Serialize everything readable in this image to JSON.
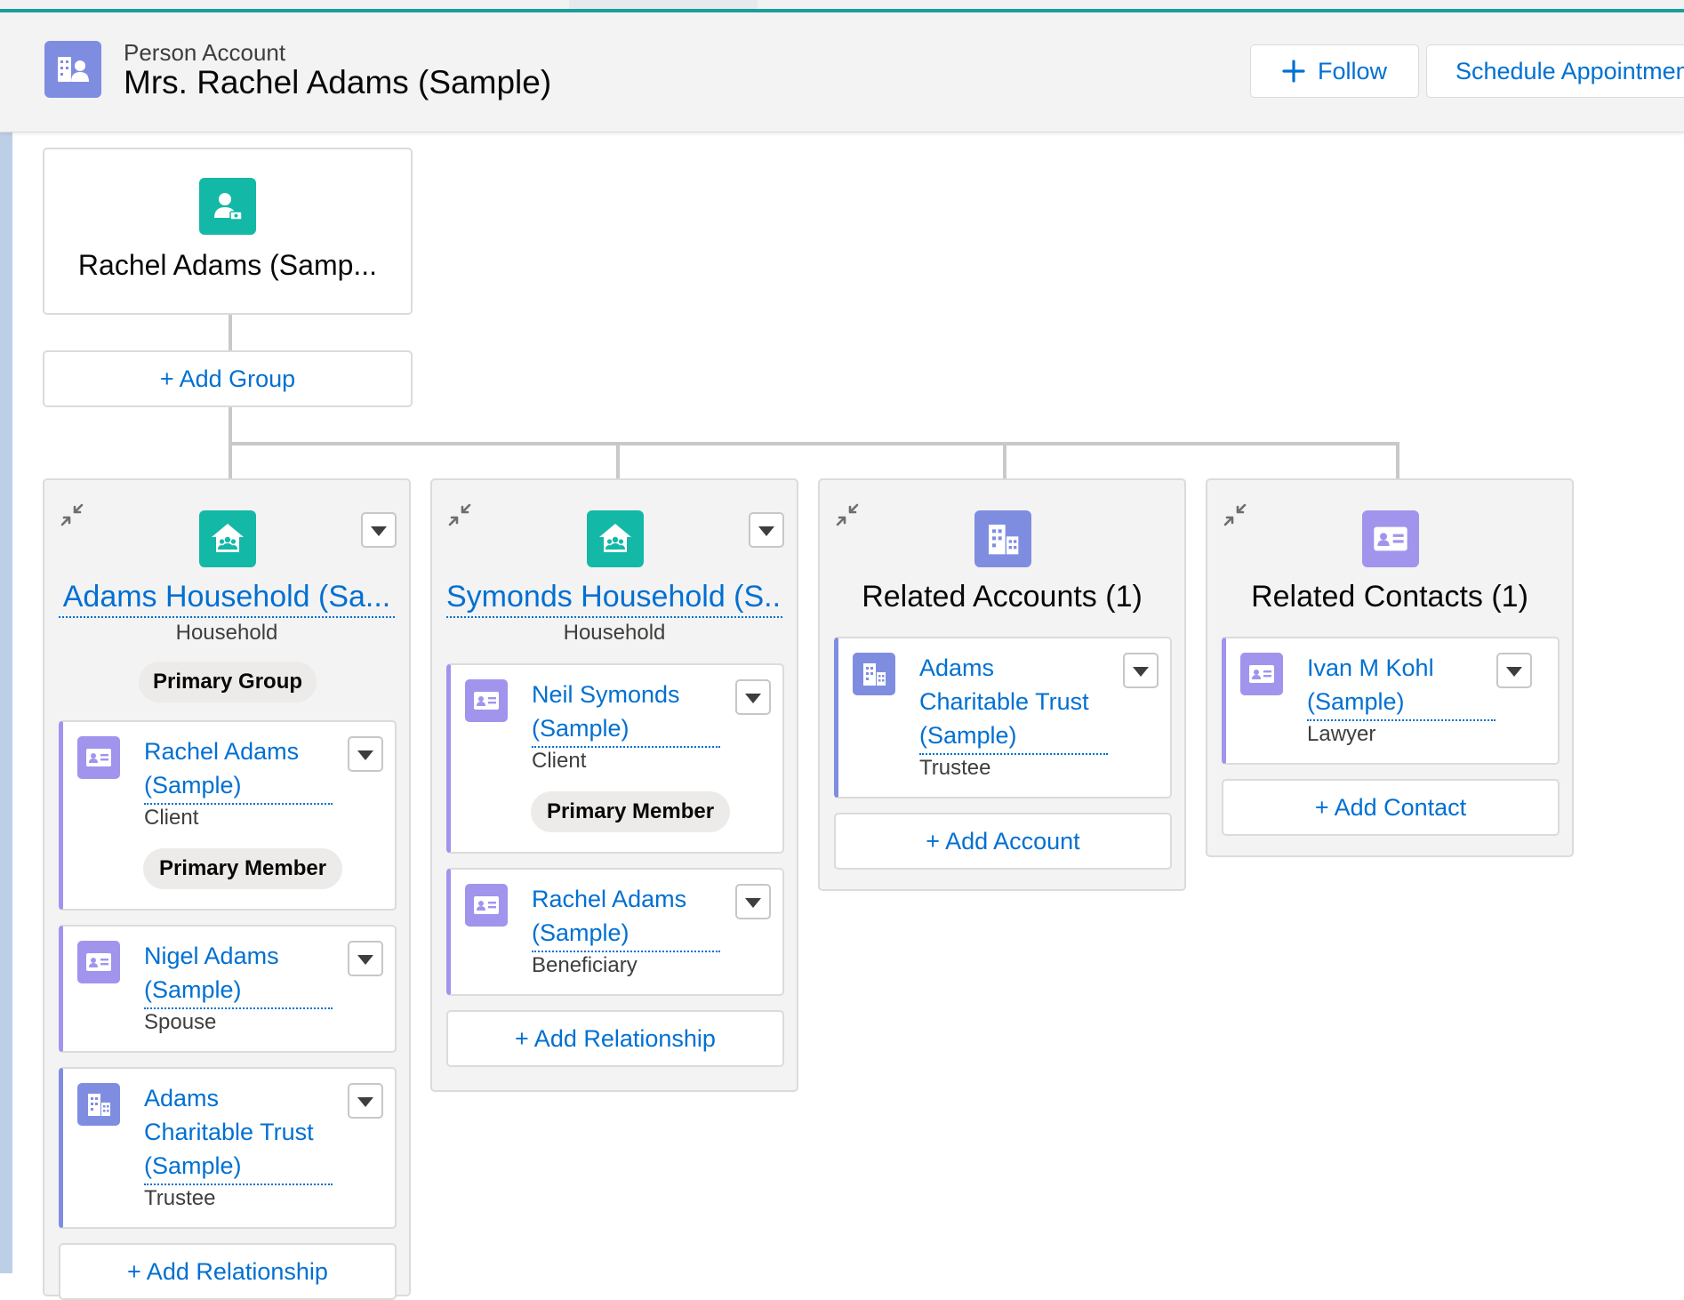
{
  "header": {
    "object_type": "Person Account",
    "record_name": "Mrs. Rachel Adams (Sample)",
    "object_icon": "person-account-icon",
    "follow_label": "Follow",
    "schedule_label": "Schedule Appointment"
  },
  "root": {
    "name": "Rachel Adams (Samp...",
    "icon": "client-icon",
    "add_group_label": "+ Add Group"
  },
  "columns": [
    {
      "title": "Adams Household (Sa...",
      "subtitle": "Household",
      "badge": "Primary Group",
      "icon": "household-icon",
      "members": [
        {
          "name": "Rachel Adams (Sample)",
          "role": "Client",
          "badge": "Primary Member",
          "icon": "contact-card-icon"
        },
        {
          "name": "Nigel Adams (Sample)",
          "role": "Spouse",
          "icon": "contact-card-icon"
        },
        {
          "name": "Adams Charitable Trust (Sample)",
          "role": "Trustee",
          "icon": "account-building-icon"
        }
      ],
      "add_label": "+ Add Relationship"
    },
    {
      "title": "Symonds Household (S...",
      "subtitle": "Household",
      "icon": "household-icon",
      "members": [
        {
          "name": "Neil Symonds (Sample)",
          "role": "Client",
          "badge": "Primary Member",
          "icon": "contact-card-icon"
        },
        {
          "name": "Rachel Adams (Sample)",
          "role": "Beneficiary",
          "icon": "contact-card-icon"
        }
      ],
      "add_label": "+ Add Relationship"
    },
    {
      "title": "Related Accounts (1)",
      "icon": "account-building-icon",
      "members": [
        {
          "name": "Adams Charitable Trust (Sample)",
          "role": "Trustee",
          "icon": "account-building-icon"
        }
      ],
      "add_label": "+ Add Account"
    },
    {
      "title": "Related Contacts (1)",
      "icon": "contact-card-icon",
      "members": [
        {
          "name": "Ivan M Kohl (Sample)",
          "role": "Lawyer",
          "icon": "contact-card-icon"
        }
      ],
      "add_label": "+ Add Contact"
    }
  ],
  "colors": {
    "link": "#0070d2",
    "household_icon": "#14b8a6",
    "account_icon": "#7f8de1",
    "contact_icon": "#a094ed",
    "accent_bar": "#1b9e9b"
  }
}
